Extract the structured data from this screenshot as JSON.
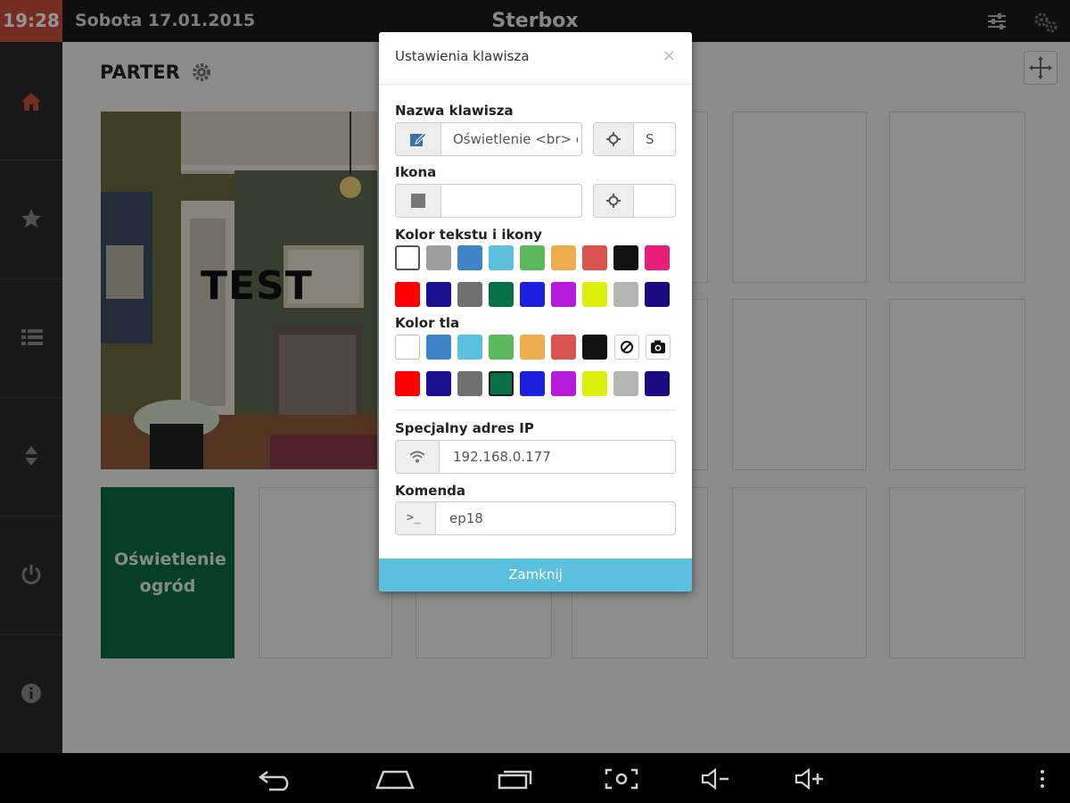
{
  "topbar": {
    "time": "19:28",
    "date": "Sobota 17.01.2015",
    "title": "Sterbox",
    "sliders_icon": "sliders-icon",
    "settings_icon": "gears-icon"
  },
  "sidebar": {
    "items": [
      {
        "icon": "home-icon",
        "active": true
      },
      {
        "icon": "star-icon"
      },
      {
        "icon": "list-icon"
      },
      {
        "icon": "sort-icon"
      },
      {
        "icon": "power-icon"
      },
      {
        "icon": "info-icon"
      }
    ]
  },
  "main": {
    "floor_title": "PARTER",
    "photo_tile_label": "TEST",
    "green_tile_label": "Oświetlenie ogród"
  },
  "dialog": {
    "title": "Ustawienia klawisza",
    "close": "×",
    "name_label": "Nazwa klawisza",
    "name_value": "Oświetlenie <br> ogród",
    "name_size_value": "S",
    "icon_label": "Ikona",
    "icon_value": "",
    "icon_size_value": "",
    "text_color_label": "Kolor tekstu i ikony",
    "text_colors_row1": [
      "#ffffff",
      "#9e9e9e",
      "#3d85c6",
      "#5bc0de",
      "#5cb85c",
      "#f0ad4e",
      "#d9534f",
      "#111111",
      "#e91e7a"
    ],
    "text_colors_row2": [
      "#ff0000",
      "#1a0f8f",
      "#707070",
      "#067047",
      "#1f1fe0",
      "#b61adb",
      "#dcef0d",
      "#b3b5b3",
      "#1c0a80"
    ],
    "bg_color_label": "Kolor tla",
    "bg_colors_row1": [
      "#ffffff",
      "#3d85c6",
      "#5bc0de",
      "#5cb85c",
      "#f0ad4e",
      "#d9534f",
      "#111111"
    ],
    "bg_colors_row2": [
      "#ff0000",
      "#1a0f8f",
      "#707070",
      "#067047",
      "#1f1fe0",
      "#b61adb",
      "#dcef0d",
      "#b3b5b3",
      "#1c0a80"
    ],
    "ip_label": "Specjalny adres IP",
    "ip_value": "192.168.0.177",
    "command_label": "Komenda",
    "command_prompt": ">_",
    "command_value": "ep18",
    "close_button": "Zamknij"
  },
  "colors": {
    "accent": "#c8503a",
    "footer_button": "#5bc0de",
    "green_tile": "#0b6b46"
  }
}
